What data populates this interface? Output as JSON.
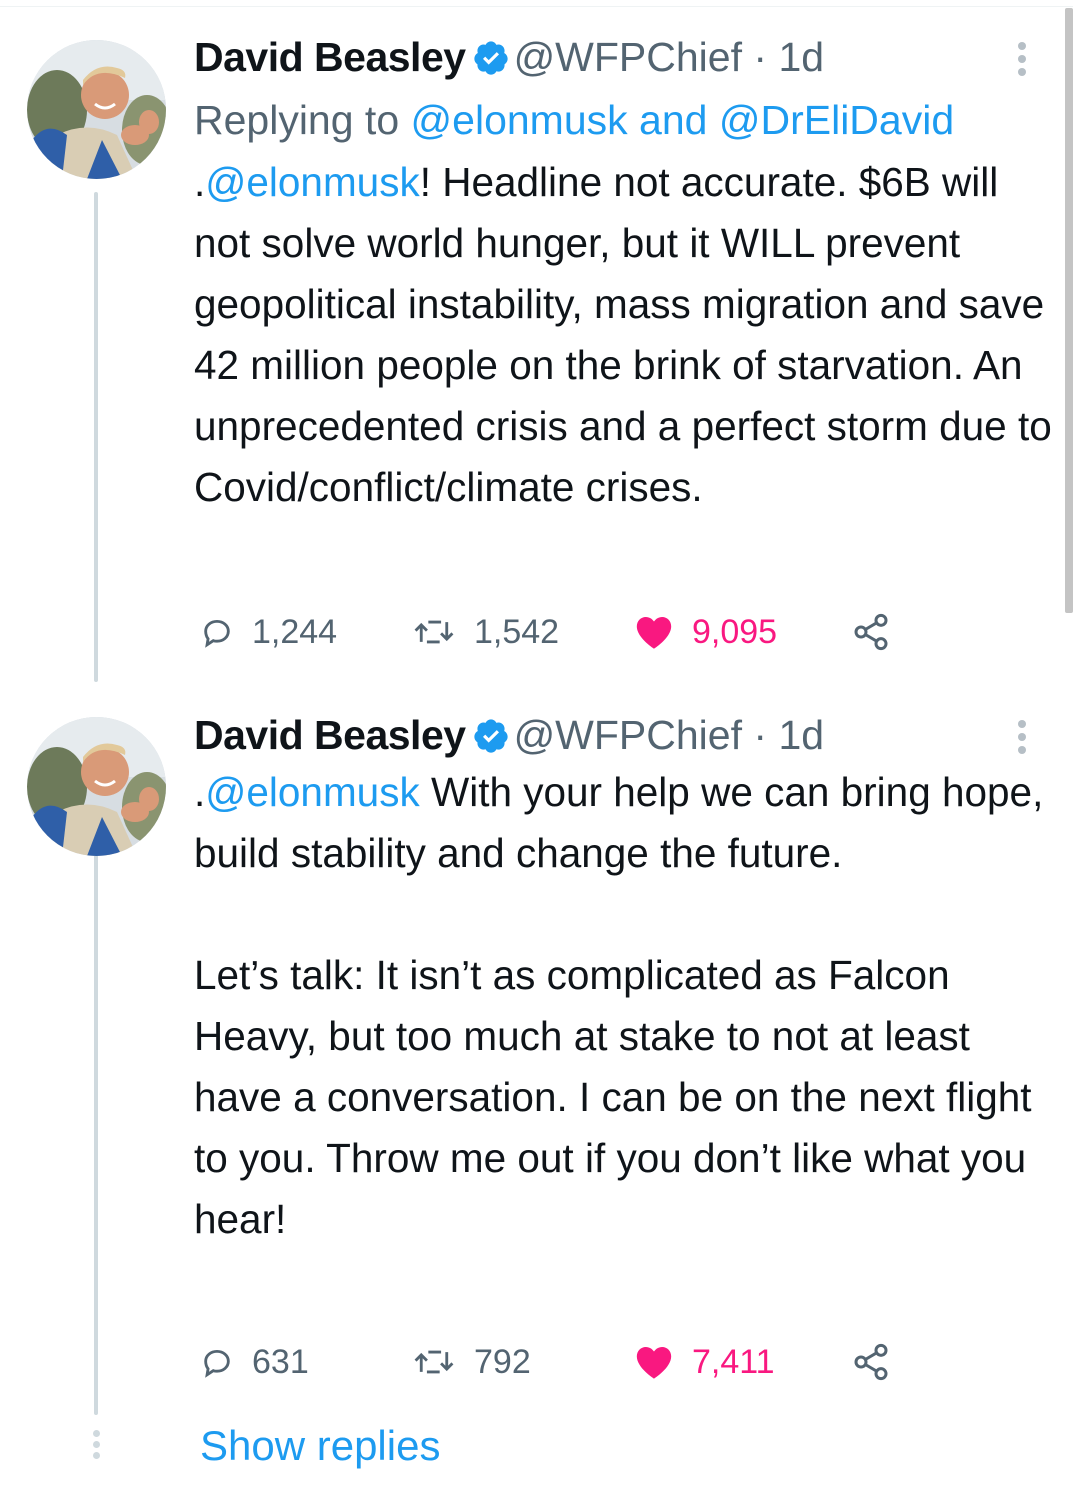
{
  "tweets": [
    {
      "author_name": "David Beasley",
      "handle": "@WFPChief",
      "separator": "·",
      "time": "1d",
      "replying_prefix": "Replying to",
      "replying_user1": "@elonmusk",
      "replying_and": "and",
      "replying_user2": "@DrEliDavid",
      "text_prefix": ".",
      "mention": "@elonmusk",
      "text": "! Headline not accurate. $6B will not solve world hunger, but it WILL prevent geopolitical instability, mass migration and save 42 million people on the brink of starvation. An unprecedented crisis and a perfect storm due to Covid/conflict/climate crises.",
      "replies": "1,244",
      "retweets": "1,542",
      "likes": "9,095"
    },
    {
      "author_name": "David Beasley",
      "handle": "@WFPChief",
      "separator": "·",
      "time": "1d",
      "text_prefix": ".",
      "mention": "@elonmusk",
      "text": " With your help we can bring hope, build stability and change the future.",
      "text2": "Let’s talk: It isn’t as complicated as Falcon Heavy, but too much at stake to not at least have a conversation. I can be on the next flight to you. Throw me out if you don’t like what you hear!",
      "replies": "631",
      "retweets": "792",
      "likes": "7,411"
    }
  ],
  "show_replies_label": "Show replies",
  "colors": {
    "link": "#1d9bf0",
    "like": "#f91880",
    "secondary_text": "#536471",
    "verified": "#1d9bf0"
  },
  "icons": [
    "verified-badge-icon",
    "more-options-icon",
    "reply-icon",
    "retweet-icon",
    "like-heart-icon",
    "share-icon"
  ]
}
